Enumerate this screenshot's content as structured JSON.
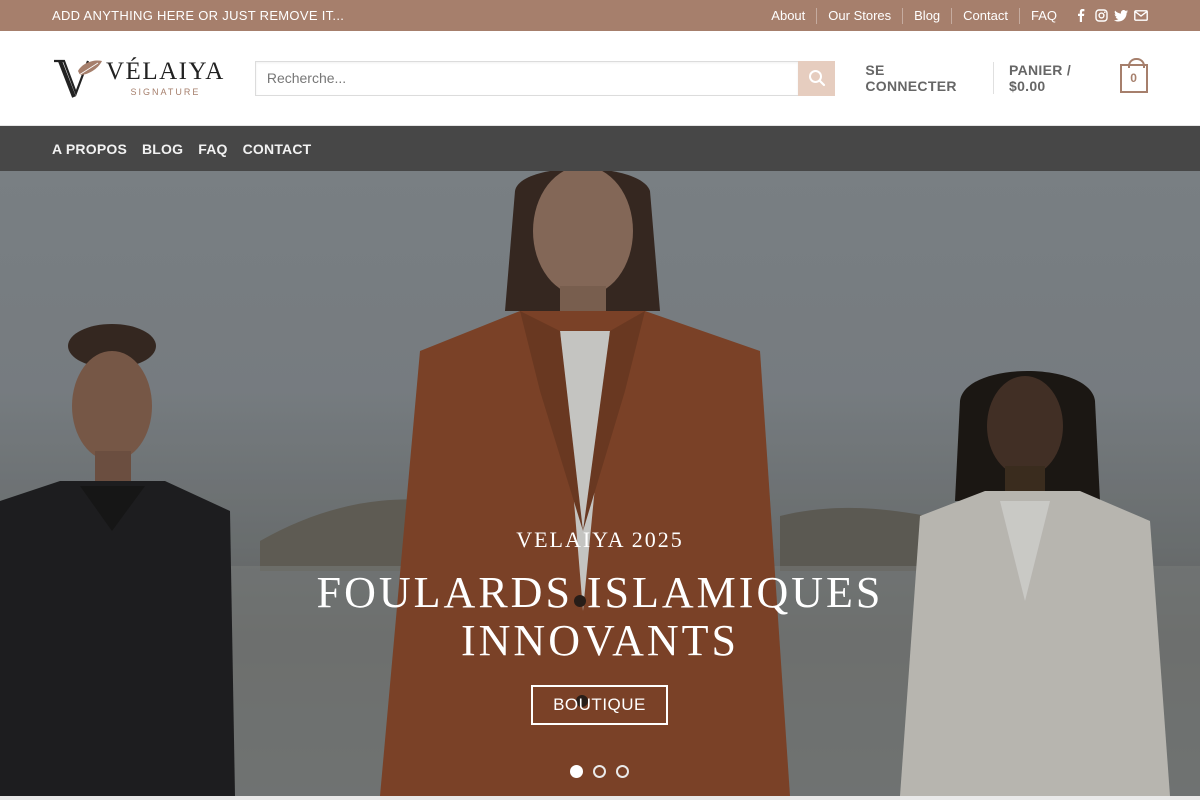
{
  "topbar": {
    "promo": "ADD ANYTHING HERE OR JUST REMOVE IT...",
    "links": [
      "About",
      "Our Stores",
      "Blog",
      "Contact",
      "FAQ"
    ],
    "social_icons": [
      "facebook-icon",
      "instagram-icon",
      "twitter-icon",
      "email-icon"
    ],
    "bg_color": "#a67f6c"
  },
  "header": {
    "logo": {
      "brand": "VÉLAIYA",
      "tagline": "SIGNATURE"
    },
    "search": {
      "placeholder": "Recherche...",
      "icon": "search-icon"
    },
    "account_label": "SE CONNECTER",
    "cart_label": "PANIER / $0.00",
    "cart_count": "0"
  },
  "nav": {
    "items": [
      "A PROPOS",
      "BLOG",
      "FAQ",
      "CONTACT"
    ]
  },
  "hero": {
    "kicker": "VELAIYA 2025",
    "title_line1": "FOULARDS ISLAMIQUES",
    "title_line2": "INNOVANTS",
    "button_label": "BOUTIQUE",
    "slides": 3,
    "active_slide": 1
  }
}
